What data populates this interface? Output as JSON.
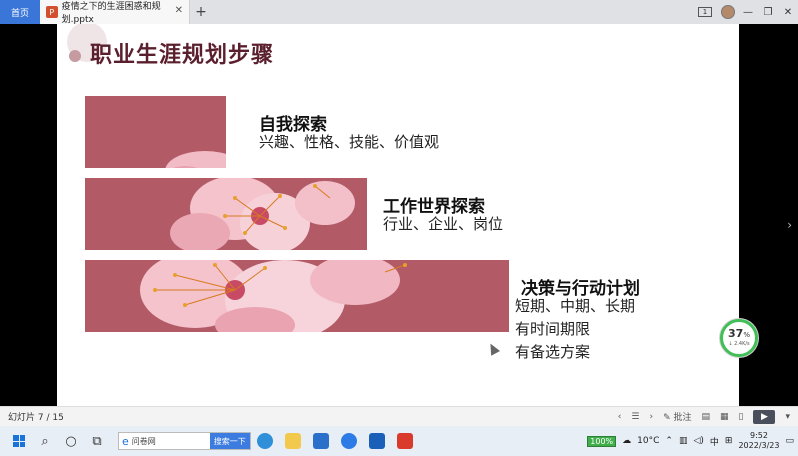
{
  "tabs": {
    "home": "首页",
    "document": "疫情之下的生涯困惑和规划.pptx",
    "new_tab": "+",
    "page_badge": "1"
  },
  "slide": {
    "title": "职业生涯规划步骤",
    "sections": [
      {
        "title": "自我探索",
        "lines": [
          "兴趣、性格、技能、价值观"
        ]
      },
      {
        "title": "工作世界探索",
        "lines": [
          "行业、企业、岗位"
        ]
      },
      {
        "title": "决策与行动计划",
        "lines": [
          "短期、中期、长期",
          "有时间期限",
          "有备选方案"
        ]
      }
    ]
  },
  "gauge": {
    "percent": "37",
    "unit": "%",
    "net": "↓ 2.4K/s"
  },
  "statusbar": {
    "slide_counter": "幻灯片 7 / 15",
    "note_label": "批注"
  },
  "taskbar": {
    "search_text": "问卷网",
    "search_button": "搜索一下",
    "battery": "100%",
    "weather": "10°C",
    "ime": "中",
    "time": "9:52",
    "date": "2022/3/23"
  },
  "colors": {
    "title": "#5a1f2d",
    "flower_bg": "#b25a66",
    "accent": "#3a76d8"
  }
}
